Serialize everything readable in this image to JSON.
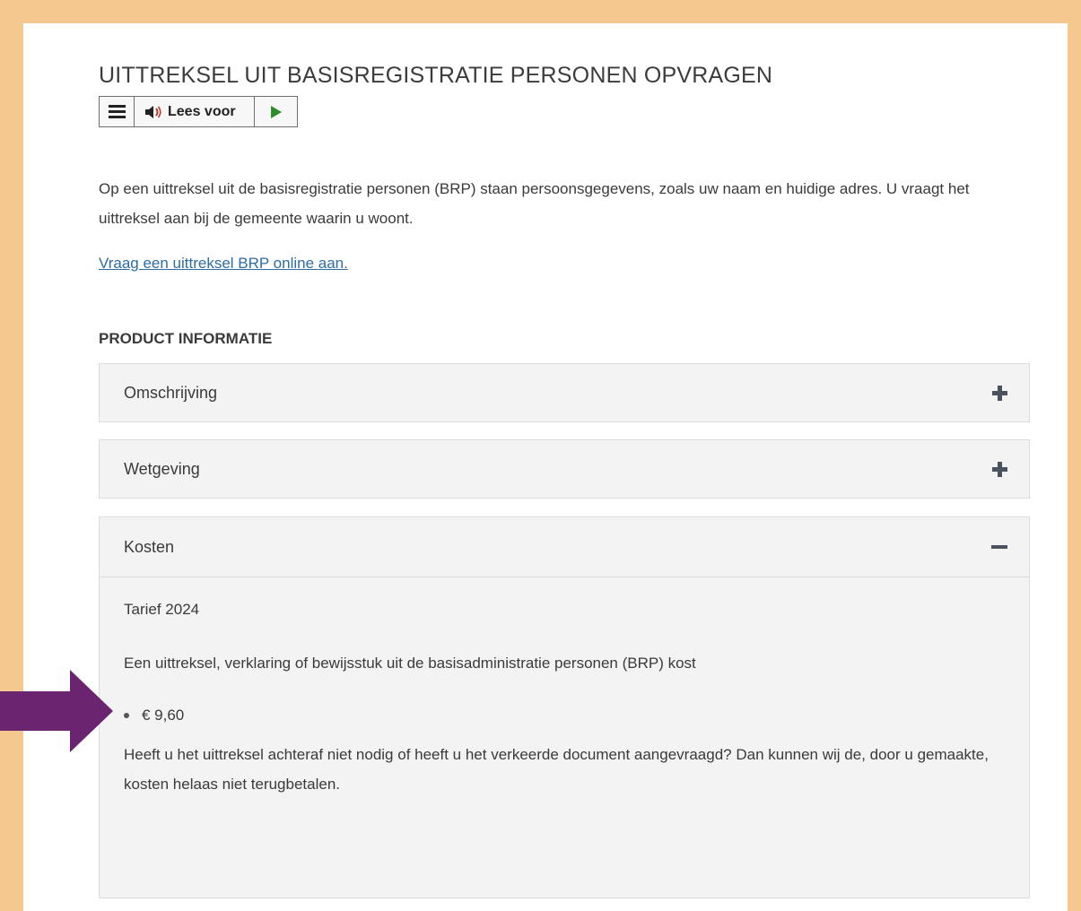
{
  "page": {
    "title": "UITTREKSEL UIT BASISREGISTRATIE PERSONEN OPVRAGEN",
    "readspeaker": {
      "menu_icon": "menu-icon",
      "speaker_icon": "speaker-icon",
      "label": "Lees voor",
      "play_icon": "play-icon"
    },
    "intro": "Op een uittreksel uit de basisregistratie personen (BRP) staan persoonsgegevens, zoals uw naam en huidige adres. U vraagt het uittreksel aan bij de gemeente waarin u woont.",
    "link": "Vraag een uittreksel BRP online aan.",
    "section_heading": "PRODUCT INFORMATIE"
  },
  "accordion": {
    "items": [
      {
        "title": "Omschrijving",
        "state": "collapsed",
        "icon": "plus-icon"
      },
      {
        "title": "Wetgeving",
        "state": "collapsed",
        "icon": "plus-icon"
      },
      {
        "title": "Kosten",
        "state": "expanded",
        "icon": "minus-icon"
      }
    ],
    "kosten": {
      "tarief": "Tarief 2024",
      "description": "Een uittreksel, verklaring of bewijsstuk uit de basisadministratie personen (BRP) kost",
      "price": "€ 9,60",
      "note": "Heeft u het uittreksel achteraf niet nodig of heeft u het verkeerde document aangevraagd? Dan kunnen wij de, door u gemaakte, kosten helaas niet terugbetalen."
    }
  },
  "colors": {
    "frame": "#f5c88f",
    "arrow": "#6b2570",
    "link": "#2d6da3",
    "panel": "#f3f3f3"
  }
}
